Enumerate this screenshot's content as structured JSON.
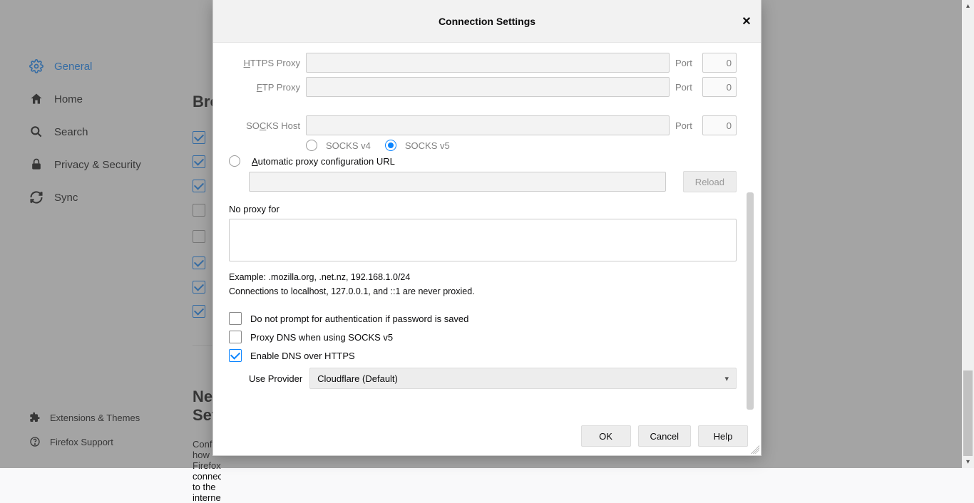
{
  "sidebar": {
    "items": [
      {
        "label": "General"
      },
      {
        "label": "Home"
      },
      {
        "label": "Search"
      },
      {
        "label": "Privacy & Security"
      },
      {
        "label": "Sync"
      }
    ],
    "footer": [
      {
        "label": "Extensions & Themes"
      },
      {
        "label": "Firefox Support"
      }
    ]
  },
  "bg": {
    "section1": "Browsing",
    "section2": "Network Settings",
    "conf": "Configure how Firefox connects to the internet."
  },
  "dialog": {
    "title": "Connection Settings",
    "https_label": "HTTPS Proxy",
    "ftp_label": "FTP Proxy",
    "socks_label": "SOCKS Host",
    "port_label": "Port",
    "port_value": "0",
    "socks_v4": "SOCKS v4",
    "socks_v5": "SOCKS v5",
    "auto_label": "Automatic proxy configuration URL",
    "reload": "Reload",
    "noproxy_label": "No proxy for",
    "example": "Example: .mozilla.org, .net.nz, 192.168.1.0/24",
    "never_proxied": "Connections to localhost, 127.0.0.1, and ::1 are never proxied.",
    "chk_auth": "Do not prompt for authentication if password is saved",
    "chk_dns": "Proxy DNS when using SOCKS v5",
    "chk_doh": "Enable DNS over HTTPS",
    "provider_label": "Use Provider",
    "provider_value": "Cloudflare (Default)",
    "ok": "OK",
    "cancel": "Cancel",
    "help": "Help"
  }
}
